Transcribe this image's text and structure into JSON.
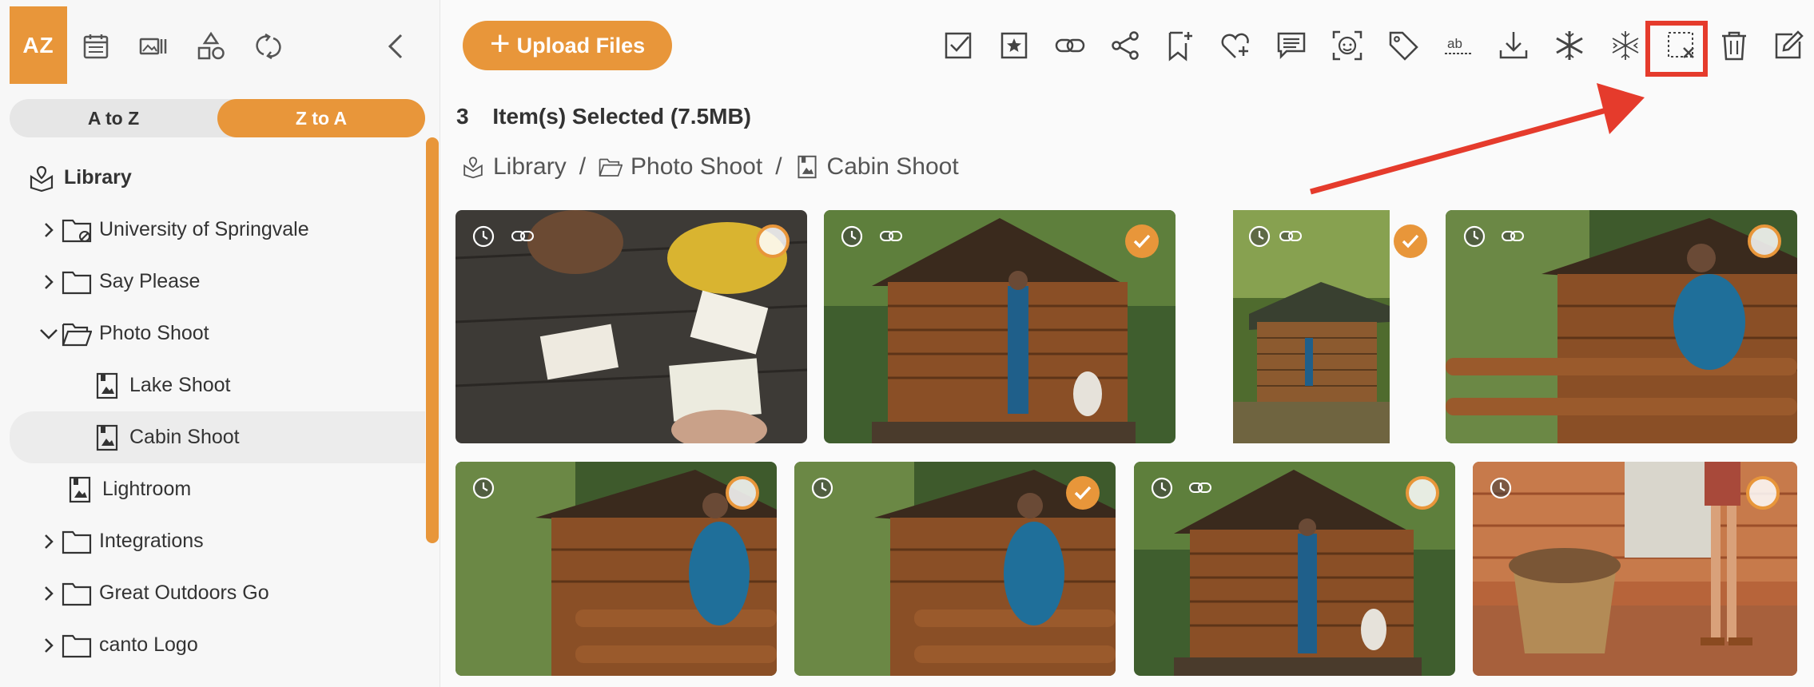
{
  "sidebar": {
    "tools": [
      "az-sort-icon",
      "calendar-icon",
      "gallery-icon",
      "shapes-icon",
      "refresh-icon",
      "collapse-icon"
    ],
    "az_label": "AZ",
    "sort": {
      "a_to_z": "A to Z",
      "z_to_a": "Z to A",
      "active": "z_to_a"
    },
    "tree": [
      {
        "label": "Library",
        "type": "library"
      },
      {
        "label": "University of Springvale",
        "type": "folder-shared"
      },
      {
        "label": "Say Please",
        "type": "folder"
      },
      {
        "label": "Photo Shoot",
        "type": "folder-open"
      },
      {
        "label": "Lake Shoot",
        "type": "album"
      },
      {
        "label": "Cabin Shoot",
        "type": "album",
        "selected": true
      },
      {
        "label": "Lightroom",
        "type": "album"
      },
      {
        "label": "Integrations",
        "type": "folder"
      },
      {
        "label": "Great Outdoors Go",
        "type": "folder"
      },
      {
        "label": "canto Logo",
        "type": "folder"
      }
    ]
  },
  "toolbar": {
    "upload_label": "Upload Files",
    "icons": [
      "select-all-icon",
      "star-icon",
      "link-icon",
      "share-icon",
      "bookmark-add-icon",
      "favorite-icon",
      "comment-icon",
      "face-icon",
      "tag-icon",
      "rename-icon",
      "download-icon",
      "freeze-icon",
      "unfreeze-icon",
      "deselect-icon",
      "trash-icon",
      "edit-icon"
    ]
  },
  "selection": {
    "count": "3",
    "text": "Item(s) Selected (7.5MB)"
  },
  "breadcrumb": [
    "Library",
    "Photo Shoot",
    "Cabin Shoot"
  ],
  "photos": [
    {
      "name": "Students studying at wooden table",
      "checked": false,
      "link": true
    },
    {
      "name": "Hiker and dog at cabin",
      "checked": true,
      "link": true
    },
    {
      "name": "Cabin in forest",
      "checked": true,
      "link": true
    },
    {
      "name": "Hiker leaning on cabin rail",
      "checked": false,
      "link": true
    },
    {
      "name": "Hiker on phone at cabin",
      "checked": false,
      "link": false
    },
    {
      "name": "Hiker on phone at cabin 2",
      "checked": true,
      "link": false
    },
    {
      "name": "Hiker and dog at cabin 2",
      "checked": false,
      "link": true
    },
    {
      "name": "Basket of firewood",
      "checked": false,
      "link": false
    }
  ],
  "colors": {
    "accent": "#e8963a",
    "callout": "#e53b2c"
  }
}
